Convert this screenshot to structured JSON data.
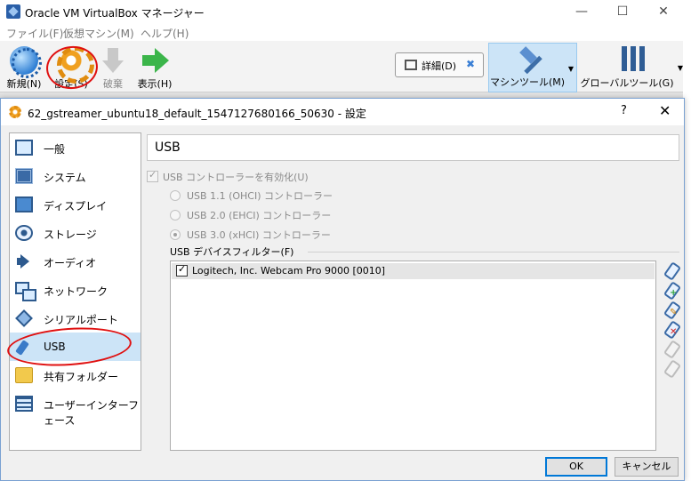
{
  "main_window": {
    "title": "Oracle VM VirtualBox マネージャー",
    "controls": {
      "minimize": "—",
      "maximize": "☐",
      "close": "✕"
    },
    "menu": [
      "ファイル(F)",
      "仮想マシン(M)",
      "ヘルプ(H)"
    ],
    "toolbar": {
      "new_label": "新規(N)",
      "settings_label": "設定(S)",
      "discard_label": "破棄",
      "show_label": "表示(H)",
      "details_label": "詳細(D)",
      "machine_tools_label": "マシンツール(M)",
      "global_tools_label": "グローバルツール(G)"
    }
  },
  "dialog": {
    "title": "62_gstreamer_ubuntu18_default_1547127680166_50630 - 設定",
    "help": "?",
    "close": "✕",
    "categories": [
      "一般",
      "システム",
      "ディスプレイ",
      "ストレージ",
      "オーディオ",
      "ネットワーク",
      "シリアルポート",
      "USB",
      "共有フォルダー",
      "ユーザーインターフェース"
    ],
    "selected_category": "USB",
    "section_title": "USB",
    "enable_usb_label": "USB コントローラーを有効化(U)",
    "usb_options": [
      "USB 1.1 (OHCI) コントローラー",
      "USB 2.0 (EHCI) コントローラー",
      "USB 3.0 (xHCI) コントローラー"
    ],
    "selected_usb_option": "USB 3.0 (xHCI) コントローラー",
    "filters_label": "USB デバイスフィルター(F)",
    "filters": [
      {
        "label": "Logitech, Inc. Webcam Pro 9000 [0010]",
        "checked": true
      }
    ],
    "ok_label": "OK",
    "cancel_label": "キャンセル"
  }
}
